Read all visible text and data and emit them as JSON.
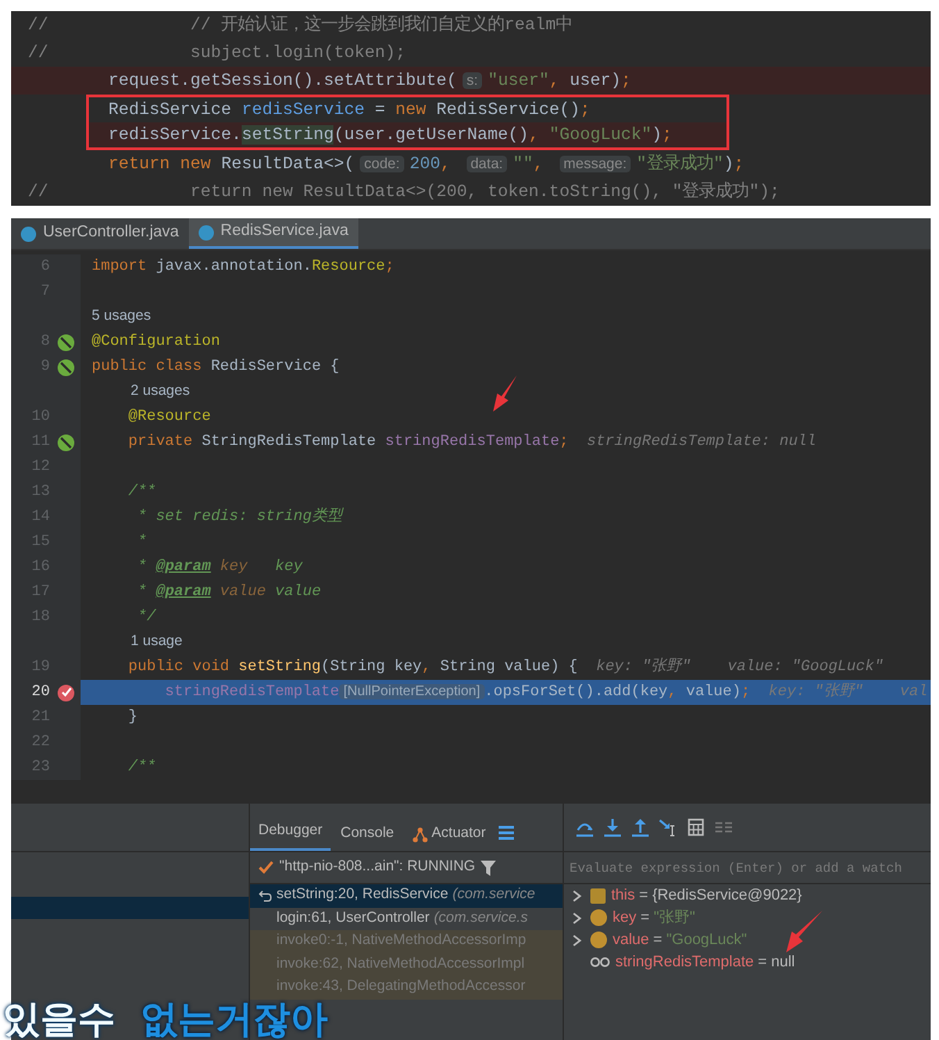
{
  "snippet": {
    "lines": [
      {
        "gutter": "//",
        "highlight": false,
        "boxed": false,
        "tokens": [
          {
            "kind": "comment",
            "text": "        // 开始认证，这一步会跳到我们自定义的realm中"
          }
        ]
      },
      {
        "gutter": "//",
        "highlight": false,
        "boxed": false,
        "tokens": [
          {
            "kind": "comment",
            "text": "        subject.login(token);"
          }
        ]
      },
      {
        "highlight": true,
        "boxed": false,
        "tokens": [
          {
            "kind": "plain",
            "text": "request.getSession().setAttribute("
          },
          {
            "kind": "inlay",
            "text": "s:"
          },
          {
            "kind": "str",
            "text": "\"user\""
          },
          {
            "kind": "kw",
            "text": ", "
          },
          {
            "kind": "plain",
            "text": "user)"
          },
          {
            "kind": "kw",
            "text": ";"
          }
        ]
      },
      {
        "highlight": false,
        "boxed": true,
        "tokens": [
          {
            "kind": "plain",
            "text": "RedisService "
          },
          {
            "kind": "local",
            "text": "redisService"
          },
          {
            "kind": "plain",
            "text": " = "
          },
          {
            "kind": "kw",
            "text": "new "
          },
          {
            "kind": "plain",
            "text": "RedisService()"
          },
          {
            "kind": "kw",
            "text": ";"
          }
        ]
      },
      {
        "highlight": true,
        "boxed": true,
        "tokens": [
          {
            "kind": "plain",
            "text": "redisService."
          },
          {
            "kind": "usage",
            "text": "setString"
          },
          {
            "kind": "plain",
            "text": "(user.getUserName()"
          },
          {
            "kind": "kw",
            "text": ", "
          },
          {
            "kind": "str",
            "text": "\"GoogLuck\""
          },
          {
            "kind": "plain",
            "text": ")"
          },
          {
            "kind": "kw",
            "text": ";"
          }
        ]
      },
      {
        "highlight": false,
        "boxed": false,
        "tokens": [
          {
            "kind": "kw",
            "text": "return new "
          },
          {
            "kind": "plain",
            "text": "ResultData<>("
          },
          {
            "kind": "inlay",
            "text": "code:"
          },
          {
            "kind": "num",
            "text": "200"
          },
          {
            "kind": "kw",
            "text": ", "
          },
          {
            "kind": "inlay",
            "text": "data:"
          },
          {
            "kind": "str",
            "text": "\"\""
          },
          {
            "kind": "kw",
            "text": ", "
          },
          {
            "kind": "inlay",
            "text": "message:"
          },
          {
            "kind": "str",
            "text": "\"登录成功\""
          },
          {
            "kind": "plain",
            "text": ")"
          },
          {
            "kind": "kw",
            "text": ";"
          }
        ]
      },
      {
        "gutter": "//",
        "highlight": false,
        "boxed": false,
        "tokens": [
          {
            "kind": "comment",
            "text": "        return new ResultData<>(200, token.toString(), \"登录成功\");"
          }
        ]
      }
    ]
  },
  "editor": {
    "tabs": [
      {
        "label": "UserController.java",
        "selected": false
      },
      {
        "label": "RedisService.java",
        "selected": true
      }
    ],
    "lines": [
      {
        "kind": "code",
        "number": "6",
        "selected": false,
        "tokens": [
          {
            "kind": "kw",
            "text": "import "
          },
          {
            "kind": "plain",
            "text": "javax.annotation."
          },
          {
            "kind": "ann",
            "text": "Resource"
          },
          {
            "kind": "kw",
            "text": ";"
          }
        ]
      },
      {
        "kind": "code",
        "number": "7",
        "selected": false
      },
      {
        "kind": "usage",
        "text": "5 usages"
      },
      {
        "kind": "bean",
        "number": "8",
        "selected": false,
        "tokens": [
          {
            "kind": "ann",
            "text": "@Configuration"
          }
        ]
      },
      {
        "kind": "bean",
        "number": "9",
        "selected": false,
        "tokens": [
          {
            "kind": "kw",
            "text": "public class "
          },
          {
            "kind": "plain",
            "text": "RedisService {"
          }
        ]
      },
      {
        "kind": "usage",
        "text": "2 usages"
      },
      {
        "kind": "code",
        "number": "10",
        "selected": false,
        "tokens": [
          {
            "kind": "ann",
            "text": "    @Resource"
          }
        ]
      },
      {
        "kind": "bean",
        "number": "11",
        "selected": false,
        "tokens": [
          {
            "kind": "kw",
            "text": "    private "
          },
          {
            "kind": "plain",
            "text": "StringRedisTemplate "
          },
          {
            "kind": "field",
            "text": "stringRedisTemplate"
          },
          {
            "kind": "kw",
            "text": ";"
          },
          {
            "kind": "hint",
            "text": "  stringRedisTemplate: null"
          }
        ]
      },
      {
        "kind": "code",
        "number": "12",
        "selected": false
      },
      {
        "kind": "code",
        "number": "13",
        "selected": false,
        "tokens": [
          {
            "kind": "doc",
            "text": "    /**"
          }
        ]
      },
      {
        "kind": "code",
        "number": "14",
        "selected": false,
        "tokens": [
          {
            "kind": "doc",
            "text": "     * set redis: string类型"
          }
        ]
      },
      {
        "kind": "code",
        "number": "15",
        "selected": false,
        "tokens": [
          {
            "kind": "doc",
            "text": "     *"
          }
        ]
      },
      {
        "kind": "code",
        "number": "16",
        "selected": false,
        "tokens": [
          {
            "kind": "doc",
            "text": "     * "
          },
          {
            "kind": "doctag",
            "text": "@param"
          },
          {
            "kind": "docparam",
            "text": " key"
          },
          {
            "kind": "doc",
            "text": "   key"
          }
        ]
      },
      {
        "kind": "code",
        "number": "17",
        "selected": false,
        "tokens": [
          {
            "kind": "doc",
            "text": "     * "
          },
          {
            "kind": "doctag",
            "text": "@param"
          },
          {
            "kind": "docparam",
            "text": " value"
          },
          {
            "kind": "doc",
            "text": " value"
          }
        ]
      },
      {
        "kind": "code",
        "number": "18",
        "selected": false,
        "tokens": [
          {
            "kind": "doc",
            "text": "     */"
          }
        ]
      },
      {
        "kind": "usage",
        "text": "1 usage"
      },
      {
        "kind": "code",
        "number": "19",
        "selected": false,
        "tokens": [
          {
            "kind": "kw",
            "text": "    public void "
          },
          {
            "kind": "fn",
            "text": "setString"
          },
          {
            "kind": "plain",
            "text": "(String key"
          },
          {
            "kind": "kw",
            "text": ", "
          },
          {
            "kind": "plain",
            "text": "String value) {"
          },
          {
            "kind": "hint",
            "text": "  key: \"张野\"    value: \"GoogLuck\""
          }
        ]
      },
      {
        "kind": "breakpoint",
        "number": "20",
        "selected": true,
        "tokens": [
          {
            "kind": "field",
            "text": "        stringRedisTemplate"
          },
          {
            "kind": "badge",
            "text": "[NullPointerException]"
          },
          {
            "kind": "plain",
            "text": ".opsForSet().add(key"
          },
          {
            "kind": "kw",
            "text": ", "
          },
          {
            "kind": "plain",
            "text": "value)"
          },
          {
            "kind": "kw",
            "text": ";"
          },
          {
            "kind": "hint",
            "text": "  key: \"张野\"    val"
          }
        ]
      },
      {
        "kind": "code",
        "number": "21",
        "selected": false,
        "tokens": [
          {
            "kind": "plain",
            "text": "    }"
          }
        ]
      },
      {
        "kind": "code",
        "number": "22",
        "selected": false
      },
      {
        "kind": "code",
        "number": "23",
        "selected": false,
        "tokens": [
          {
            "kind": "doc",
            "text": "    /**"
          }
        ]
      }
    ]
  },
  "debugger": {
    "tabs": [
      {
        "label": "Debugger",
        "selected": true
      },
      {
        "label": "Console",
        "selected": false
      },
      {
        "label": "Actuator",
        "selected": false
      }
    ],
    "thread": "\"http-nio-808...ain\": RUNNING",
    "frames": [
      {
        "method": "setString:20, RedisService",
        "pkg": "(com.service",
        "selected": true,
        "library": false
      },
      {
        "method": "login:61, UserController",
        "pkg": "(com.service.s",
        "selected": false,
        "library": false
      },
      {
        "method": "invoke0:-1, NativeMethodAccessorImp",
        "selected": false,
        "library": true
      },
      {
        "method": "invoke:62, NativeMethodAccessorImpl",
        "selected": false,
        "library": true
      },
      {
        "method": "invoke:43, DelegatingMethodAccessor",
        "selected": false,
        "library": true
      }
    ],
    "watch": {
      "placeholder": "Evaluate expression (Enter) or add a watch"
    },
    "variables": [
      {
        "kind": "object",
        "name": "this",
        "sign": "=",
        "value": "{RedisService@9022}",
        "expandable": true
      },
      {
        "kind": "param",
        "name": "key",
        "sign": "=",
        "value": "\"张野\"",
        "expandable": true
      },
      {
        "kind": "param",
        "name": "value",
        "sign": "=",
        "value": "\"GoogLuck\"",
        "expandable": true
      },
      {
        "kind": "field",
        "name": "stringRedisTemplate",
        "sign": "=",
        "value": "null",
        "expandable": false
      }
    ]
  },
  "subtitle": [
    {
      "text": "있을수",
      "kind": "white"
    },
    {
      "text": "없는거잖아",
      "kind": "blue"
    }
  ]
}
